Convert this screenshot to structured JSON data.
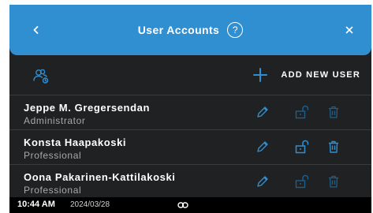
{
  "header": {
    "title": "User Accounts",
    "help_label": "?",
    "back_icon": "chevron-left-icon",
    "close_icon": "close-icon",
    "background_color": "#2f8fd1"
  },
  "toolbar": {
    "user_group_icon": "user-group-settings-icon",
    "add_user_label": "ADD NEW USER",
    "add_icon": "plus-icon"
  },
  "colors": {
    "accent": "#2f8fd1",
    "accent_dim": "#1d5f8c",
    "background": "#202122",
    "divider": "#3a3b3c"
  },
  "users": [
    {
      "name": "Jeppe M. Gregersendan",
      "role": "Administrator",
      "actions": {
        "edit": "enabled",
        "unlock": "disabled",
        "delete": "disabled"
      }
    },
    {
      "name": "Konsta Haapakoski",
      "role": "Professional",
      "actions": {
        "edit": "enabled",
        "unlock": "enabled",
        "delete": "enabled"
      }
    },
    {
      "name": "Oona Pakarinen-Kattilakoski",
      "role": "Professional",
      "actions": {
        "edit": "enabled",
        "unlock": "disabled",
        "delete": "disabled"
      }
    }
  ],
  "status_bar": {
    "time": "10:44 AM",
    "date": "2024/03/28",
    "link_icon": "link-icon"
  }
}
